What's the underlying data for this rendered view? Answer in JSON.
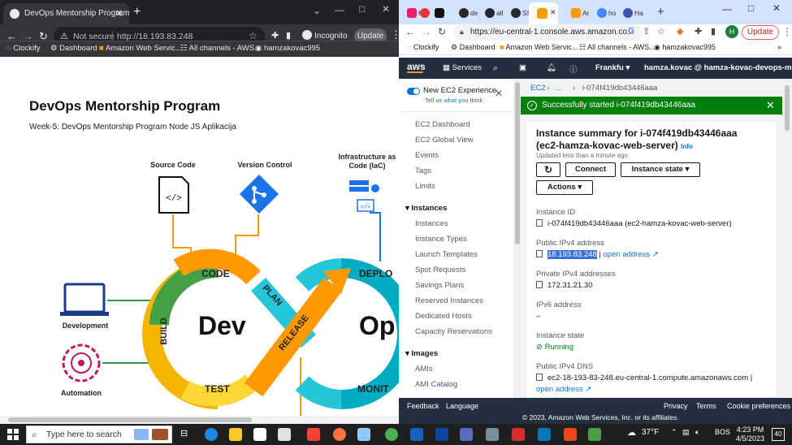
{
  "left_browser": {
    "tab_title": "DevOps Mentorship Program",
    "not_secure": "Not secure",
    "url": "http://18.193.83.248",
    "incognito": "Incognito",
    "update": "Update",
    "bookmarks": [
      "Clockify",
      "Dashboard",
      "Amazon Web Servic...",
      "All channels - AWS...",
      "hamzakovac995"
    ]
  },
  "page": {
    "title": "DevOps Mentorship Program",
    "subtitle": "Week-5: DevOps Mentorship Program Node JS Aplikacija",
    "diagram": {
      "top_labels": [
        "Source Code",
        "Version Control",
        "Infrastructure as Code (IaC)"
      ],
      "left_labels": [
        "Development",
        "Automation"
      ],
      "loop_words": {
        "code": "CODE",
        "plan": "PLAN",
        "build": "BUILD",
        "test": "TEST",
        "release": "RELEASE",
        "dev": "Dev",
        "ops": "Op",
        "deploy": "DEPLO",
        "monitor": "MONIT"
      }
    }
  },
  "right_browser": {
    "tabs": [
      "Ha",
      "",
      "",
      "de",
      "all",
      "SS",
      "",
      "Ar",
      "ho",
      "Ha"
    ],
    "url": "https://eu-central-1.console.aws.amazon.co...",
    "update": "Update",
    "profile_initial": "H",
    "bookmarks": [
      "Clockify",
      "Dashboard",
      "Amazon Web Servic...",
      "All channels - AWS...",
      "hamzakovac995"
    ]
  },
  "aws": {
    "nav": {
      "services": "Services",
      "region": "Frankfu",
      "account": "hamza.kovac @ hamza-kovac-devops-mento"
    },
    "sidebar": {
      "experience": "New EC2 Experience",
      "feedback": "Tell us what you think",
      "top_items": [
        "EC2 Dashboard",
        "EC2 Global View",
        "Events",
        "Tags",
        "Limits"
      ],
      "instances_header": "Instances",
      "instances_items": [
        "Instances",
        "Instance Types",
        "Launch Templates",
        "Spot Requests",
        "Savings Plans",
        "Reserved Instances",
        "Dedicated Hosts",
        "Capacity Reservations"
      ],
      "images_header": "Images",
      "images_items": [
        "AMIs",
        "AMI Catalog"
      ]
    },
    "breadcrumb": {
      "root": "EC2",
      "mid": "...",
      "current": "i-074f419db43446aaa"
    },
    "flash": "Successfully started i-074f419db43446aaa",
    "summary": {
      "title": "Instance summary for i-074f419db43446aaa (ec2-hamza-kovac-web-server)",
      "info": "Info",
      "updated": "Updated less than a minute ago",
      "connect": "Connect",
      "instance_state_btn": "Instance state",
      "actions": "Actions",
      "fields": {
        "instance_id_label": "Instance ID",
        "instance_id": "i-074f419db43446aaa (ec2-hamza-kovac-web-server)",
        "public_ipv4_label": "Public IPv4 address",
        "public_ipv4": "18.193.83.248",
        "open_address": "open address",
        "private_ipv4_label": "Private IPv4 addresses",
        "private_ipv4": "172.31.21.30",
        "ipv6_label": "IPv6 address",
        "ipv6": "–",
        "state_label": "Instance state",
        "state": "Running",
        "dns_label": "Public IPv4 DNS",
        "dns": "ec2-18-193-83-248.eu-central-1.compute.amazonaws.com |",
        "dns_open": "open address"
      }
    },
    "footer": {
      "feedback": "Feedback",
      "language": "Language",
      "privacy": "Privacy",
      "terms": "Terms",
      "cookies": "Cookie preferences",
      "copyright": "© 2023, Amazon Web Services, Inc. or its affiliates."
    }
  },
  "taskbar": {
    "search": "Type here to search",
    "weather": "37°F",
    "lang": "BOS",
    "time": "4:23 PM",
    "date": "4/5/2023",
    "notifications": "40"
  },
  "colors": {
    "aws_nav": "#232f3e",
    "flash_green": "#037f0c",
    "aws_orange": "#ff9900",
    "link_blue": "#0972d3"
  }
}
